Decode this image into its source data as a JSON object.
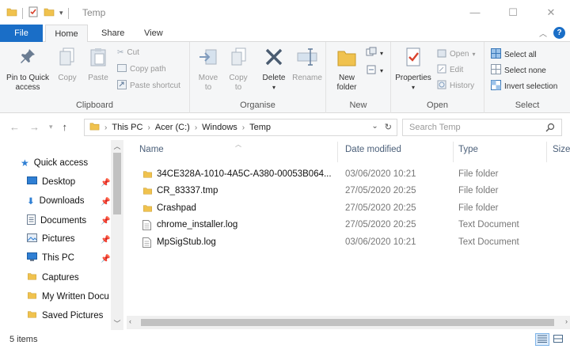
{
  "titlebar": {
    "title": "Temp",
    "qat_icons": [
      "folder-icon",
      "properties-check-icon",
      "new-folder-icon",
      "qat-dropdown-icon"
    ]
  },
  "tabs": {
    "file": "File",
    "home": "Home",
    "share": "Share",
    "view": "View"
  },
  "ribbon": {
    "clipboard": {
      "label": "Clipboard",
      "pin": "Pin to Quick\naccess",
      "copy": "Copy",
      "paste": "Paste",
      "cut": "Cut",
      "copy_path": "Copy path",
      "paste_shortcut": "Paste shortcut"
    },
    "organise": {
      "label": "Organise",
      "move_to": "Move\nto",
      "copy_to": "Copy\nto",
      "delete": "Delete",
      "rename": "Rename"
    },
    "new": {
      "label": "New",
      "new_folder": "New\nfolder"
    },
    "open": {
      "label": "Open",
      "properties": "Properties",
      "open": "Open",
      "edit": "Edit",
      "history": "History"
    },
    "select": {
      "label": "Select",
      "select_all": "Select all",
      "select_none": "Select none",
      "invert": "Invert selection"
    }
  },
  "address": {
    "crumbs": [
      "This PC",
      "Acer (C:)",
      "Windows",
      "Temp"
    ],
    "search_placeholder": "Search Temp"
  },
  "nav": {
    "items": [
      {
        "label": "Quick access",
        "icon": "star-icon",
        "pinned": false
      },
      {
        "label": "Desktop",
        "icon": "desktop-icon",
        "pinned": true
      },
      {
        "label": "Downloads",
        "icon": "download-icon",
        "pinned": true
      },
      {
        "label": "Documents",
        "icon": "documents-icon",
        "pinned": true
      },
      {
        "label": "Pictures",
        "icon": "pictures-icon",
        "pinned": true
      },
      {
        "label": "This PC",
        "icon": "this-pc-icon",
        "pinned": true
      },
      {
        "label": "Captures",
        "icon": "folder-icon",
        "pinned": false
      },
      {
        "label": "My Written Docu",
        "icon": "folder-icon",
        "pinned": false
      },
      {
        "label": "Saved Pictures",
        "icon": "folder-icon",
        "pinned": false
      }
    ]
  },
  "columns": {
    "name": "Name",
    "date": "Date modified",
    "type": "Type",
    "size": "Size"
  },
  "files": [
    {
      "name": "34CE328A-1010-4A5C-A380-00053B064...",
      "date": "03/06/2020 10:21",
      "type": "File folder",
      "kind": "folder"
    },
    {
      "name": "CR_83337.tmp",
      "date": "27/05/2020 20:25",
      "type": "File folder",
      "kind": "folder"
    },
    {
      "name": "Crashpad",
      "date": "27/05/2020 20:25",
      "type": "File folder",
      "kind": "folder"
    },
    {
      "name": "chrome_installer.log",
      "date": "27/05/2020 20:25",
      "type": "Text Document",
      "kind": "text"
    },
    {
      "name": "MpSigStub.log",
      "date": "03/06/2020 10:21",
      "type": "Text Document",
      "kind": "text"
    }
  ],
  "status": {
    "count": "5 items"
  },
  "colors": {
    "accent": "#1a6ec7",
    "folder": "#f0c24e",
    "header_text": "#4c607a"
  }
}
